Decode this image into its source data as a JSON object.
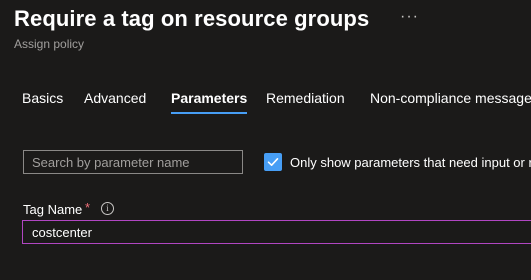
{
  "header": {
    "title": "Require a tag on resource groups",
    "more_glyph": "···",
    "subtitle": "Assign policy"
  },
  "tabs": [
    {
      "label": "Basics",
      "active": false
    },
    {
      "label": "Advanced",
      "active": false
    },
    {
      "label": "Parameters",
      "active": true
    },
    {
      "label": "Remediation",
      "active": false
    },
    {
      "label": "Non-compliance messages",
      "active": false
    }
  ],
  "filter": {
    "search_placeholder": "Search by parameter name",
    "search_value": "",
    "only_show_checked": true,
    "only_show_label": "Only show parameters that need input or review"
  },
  "parameter": {
    "label": "Tag Name",
    "required_marker": "*",
    "info_glyph": "i",
    "value": "costcenter"
  },
  "colors": {
    "background": "#1b1a19",
    "accent": "#479ef5",
    "focus_border": "#b146c2",
    "required": "#f1707b",
    "muted_text": "#a19f9d"
  }
}
